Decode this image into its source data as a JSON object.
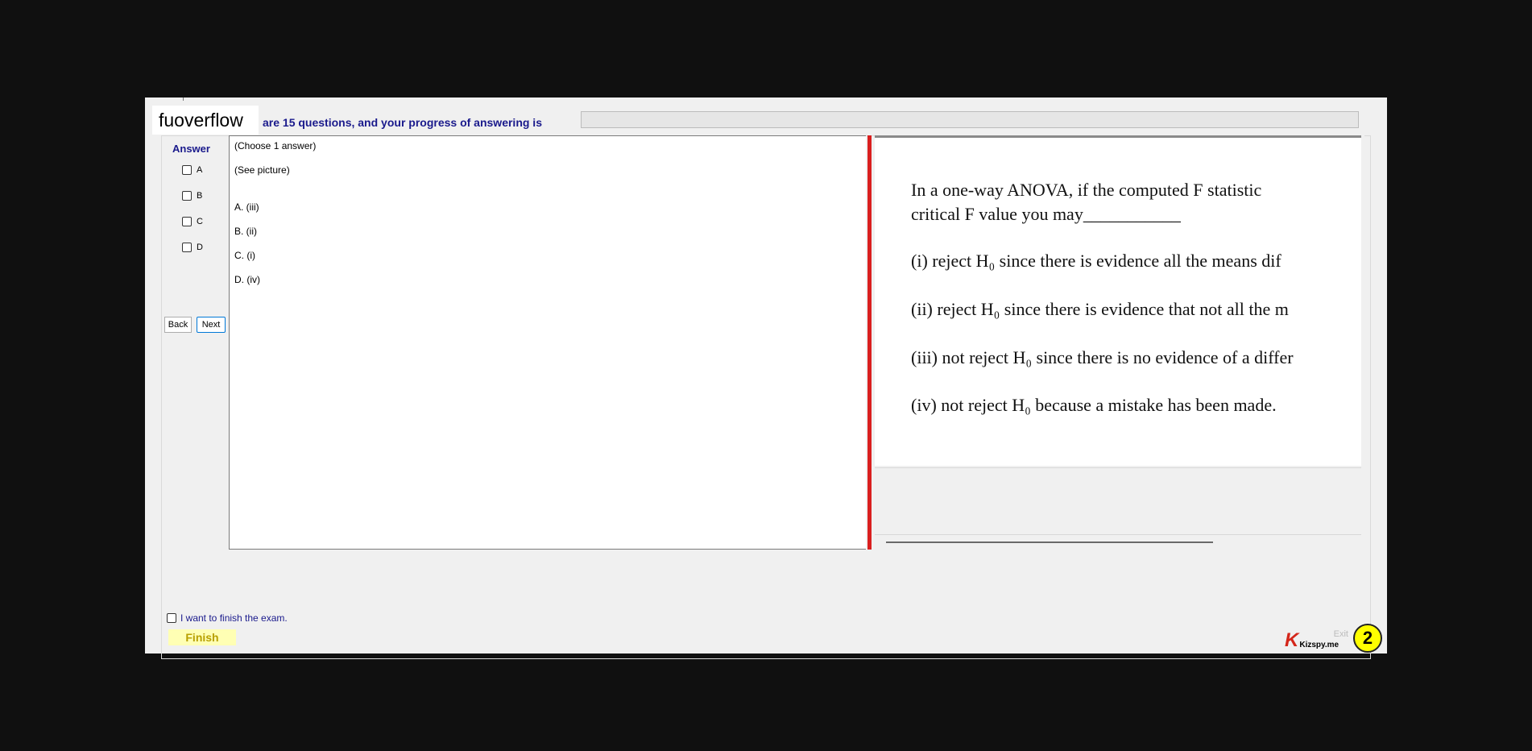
{
  "header": {
    "logo": "fuoverflow",
    "progress_text": "are 15 questions, and your progress of answering is",
    "progress_value": 0
  },
  "answer_panel": {
    "title": "Answer",
    "options": [
      "A",
      "B",
      "C",
      "D"
    ],
    "back_label": "Back",
    "next_label": "Next"
  },
  "question": {
    "instruction": "(Choose 1 answer)",
    "see_picture": "(See picture)",
    "choices": [
      "A.  (iii)",
      "B.  (ii)",
      "C.  (i)",
      "D.  (iv)"
    ]
  },
  "picture": {
    "line1": "In a one-way ANOVA, if the computed F statistic",
    "line2": "critical F value you  may___________",
    "item_i": "(i)   reject H₀ since there is evidence all the means dif",
    "item_ii": "(ii)  reject H₀ since there is evidence that not all the m",
    "item_iii": "(iii) not reject H₀ since there is no evidence of a differ",
    "item_iv": "(iv) not reject H₀ because a mistake has been made."
  },
  "footer": {
    "finish_checkbox_label": "I want to finish the exam.",
    "finish_label": "Finish",
    "exit_label": "Exit",
    "brand": "Kizspy.me",
    "brand_letter": "K",
    "badge": "2"
  },
  "colors": {
    "accent_text": "#1a1a8c",
    "divider": "#d91f1f",
    "finish_bg": "#ffffb4",
    "badge": "#ffff00"
  }
}
